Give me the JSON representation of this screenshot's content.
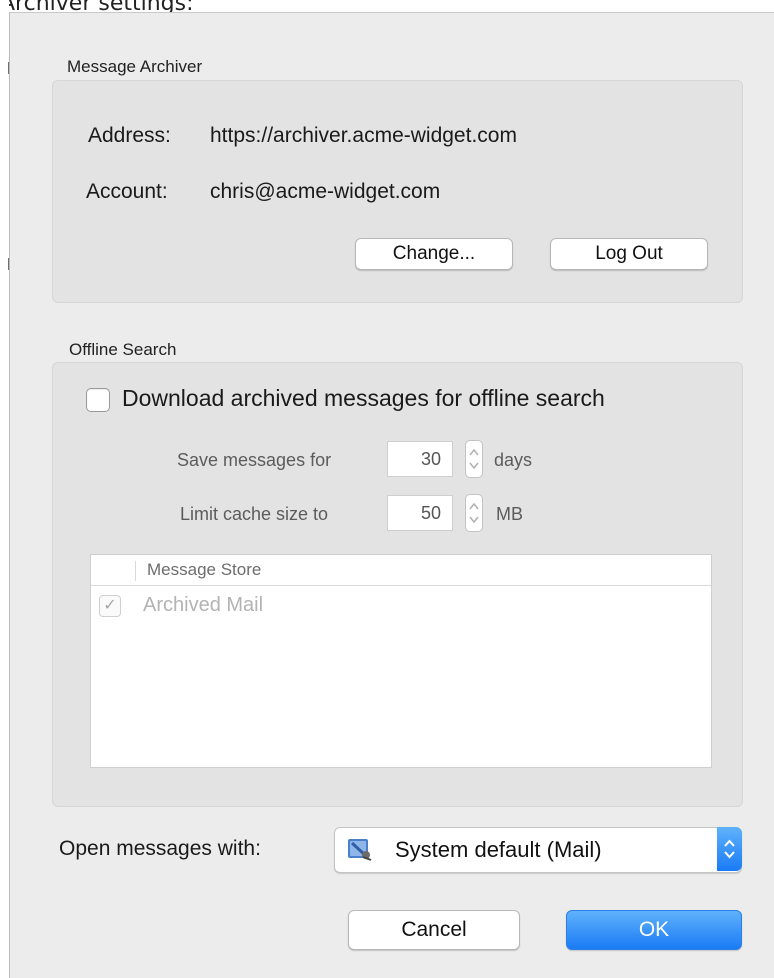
{
  "caption": "Archiver settings:",
  "archiver": {
    "title": "Message Archiver",
    "address_label": "Address:",
    "address_value": "https://archiver.acme-widget.com",
    "account_label": "Account:",
    "account_value": "chris@acme-widget.com",
    "change_button": "Change...",
    "logout_button": "Log Out"
  },
  "offline": {
    "title": "Offline Search",
    "download_label": "Download archived messages for offline search",
    "download_checked": false,
    "save_label": "Save messages for",
    "save_value": "30",
    "save_unit": "days",
    "limit_label": "Limit cache size to",
    "limit_value": "50",
    "limit_unit": "MB",
    "table": {
      "column_header": "Message Store",
      "rows": [
        {
          "label": "Archived Mail",
          "checked": true
        }
      ]
    }
  },
  "open_with": {
    "label": "Open messages with:",
    "selected": "System default (Mail)",
    "icon": "mail-app-icon"
  },
  "footer": {
    "cancel_button": "Cancel",
    "ok_button": "OK"
  },
  "colors": {
    "accent": "#1a7bf5",
    "window_bg": "#ececec",
    "group_bg": "#e3e3e3"
  }
}
